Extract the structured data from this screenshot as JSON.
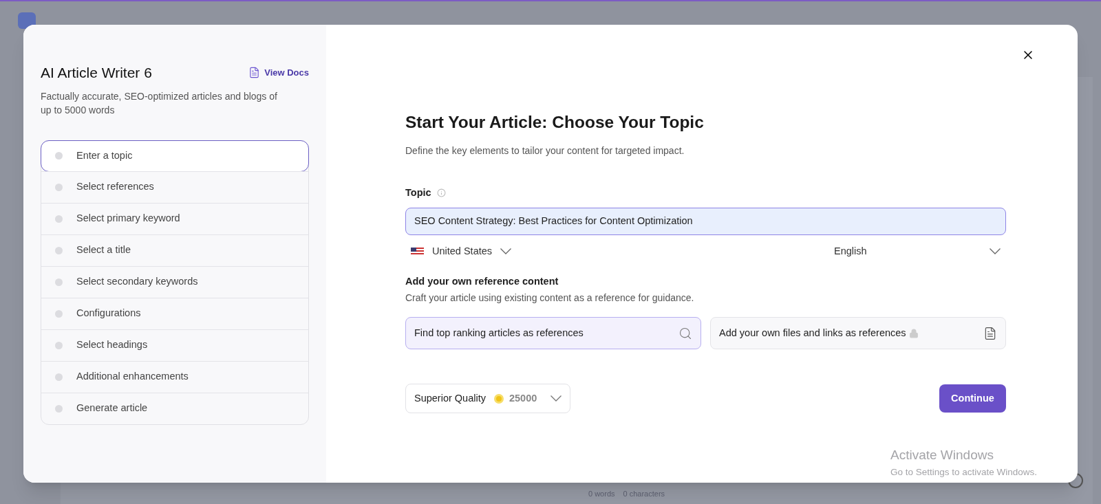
{
  "background": {
    "word_count": "0 words",
    "char_count": "0 characters"
  },
  "sidebar": {
    "title": "AI Article Writer 6",
    "docs_link": "View Docs",
    "subtitle": "Factually accurate, SEO-optimized articles and blogs of up to 5000 words",
    "steps": [
      {
        "label": "Enter a topic",
        "selected": true
      },
      {
        "label": "Select references",
        "selected": false
      },
      {
        "label": "Select primary keyword",
        "selected": false
      },
      {
        "label": "Select a title",
        "selected": false
      },
      {
        "label": "Select secondary keywords",
        "selected": false
      },
      {
        "label": "Configurations",
        "selected": false
      },
      {
        "label": "Select headings",
        "selected": false
      },
      {
        "label": "Additional enhancements",
        "selected": false
      },
      {
        "label": "Generate article",
        "selected": false
      }
    ]
  },
  "main": {
    "heading": "Start Your Article: Choose Your Topic",
    "description": "Define the key elements to tailor your content for targeted impact.",
    "topic_label": "Topic",
    "topic_value": "SEO Content Strategy: Best Practices for Content Optimization",
    "country": "United States",
    "language": "English",
    "reference_heading": "Add your own reference content",
    "reference_description": "Craft your article using existing content as a reference for guidance.",
    "reference_options": [
      {
        "label": "Find top ranking articles as references",
        "selected": true,
        "kind": "search"
      },
      {
        "label": "Add your own files and links as references",
        "selected": false,
        "kind": "files"
      }
    ],
    "quality": "Superior Quality",
    "credits": "25000",
    "continue": "Continue"
  },
  "os_notice": {
    "title": "Activate Windows",
    "text": "Go to Settings to activate Windows."
  }
}
